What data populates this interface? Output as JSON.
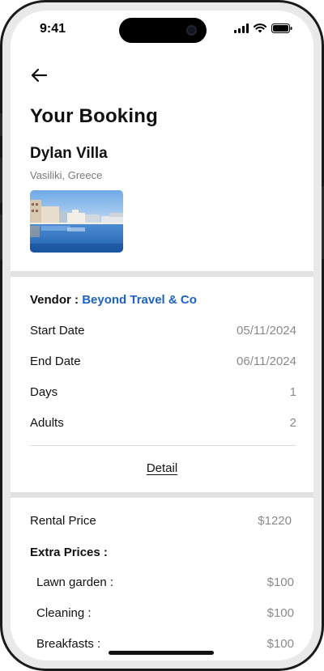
{
  "status_bar": {
    "time": "9:41"
  },
  "header": {
    "back_icon": "arrow-left-icon"
  },
  "booking": {
    "title": "Your Booking",
    "villa_name": "Dylan Villa",
    "location": "Vasiliki, Greece",
    "photo_icon": "villa-photo"
  },
  "details": {
    "vendor_label": "Vendor : ",
    "vendor_name": "Beyond Travel & Co",
    "rows": [
      {
        "label": "Start Date",
        "value": "05/11/2024"
      },
      {
        "label": "End Date",
        "value": "06/11/2024"
      },
      {
        "label": "Days",
        "value": "1"
      },
      {
        "label": "Adults",
        "value": "2"
      }
    ],
    "detail_link": "Detail"
  },
  "prices": {
    "rental_label": "Rental Price",
    "rental_value": "$1220",
    "extra_title": "Extra Prices :",
    "extras": [
      {
        "label": "Lawn garden :",
        "value": "$100"
      },
      {
        "label": "Cleaning :",
        "value": "$100"
      },
      {
        "label": "Breakfasts :",
        "value": "$100"
      }
    ]
  },
  "colors": {
    "link": "#1c63c4",
    "muted": "#8a8a8a",
    "divider": "#e2e2e2"
  }
}
